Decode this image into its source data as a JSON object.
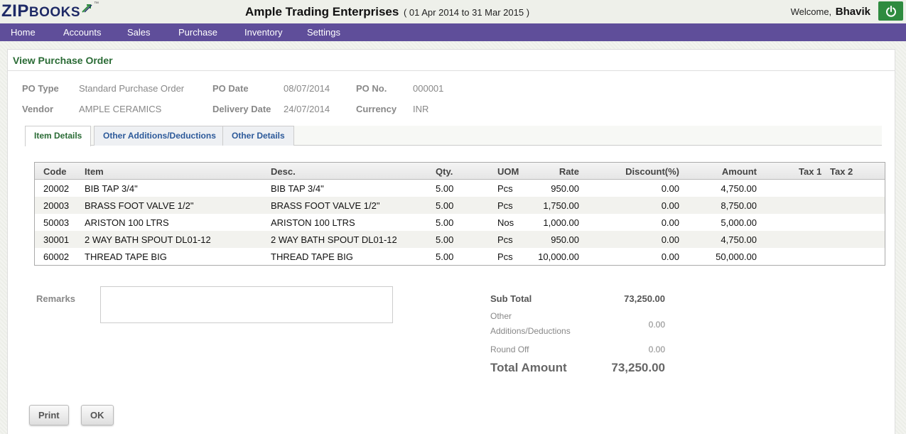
{
  "header": {
    "logo_main": "ZIP",
    "logo_rest": "BOOKS",
    "logo_tm": "™",
    "company_name": "Ample Trading Enterprises",
    "period": "( 01 Apr 2014 to 31 Mar 2015 )",
    "welcome_text": "Welcome,",
    "user_name": "Bhavik",
    "power_icon": "power-icon",
    "power_color": "#2e8b3f"
  },
  "nav": {
    "items": [
      "Home",
      "Accounts",
      "Sales",
      "Purchase",
      "Inventory",
      "Settings"
    ],
    "bg_color": "#5f4e9a"
  },
  "page": {
    "title": "View Purchase Order"
  },
  "po": {
    "type_label": "PO Type",
    "type_value": "Standard Purchase Order",
    "date_label": "PO Date",
    "date_value": "08/07/2014",
    "no_label": "PO No.",
    "no_value": "000001",
    "vendor_label": "Vendor",
    "vendor_value": "AMPLE CERAMICS",
    "delivery_label": "Delivery Date",
    "delivery_value": "24/07/2014",
    "currency_label": "Currency",
    "currency_value": "INR"
  },
  "tabs": [
    {
      "label": "Item Details",
      "active": true
    },
    {
      "label": "Other Additions/Deductions",
      "active": false
    },
    {
      "label": "Other Details",
      "active": false
    }
  ],
  "table": {
    "headers": {
      "code": "Code",
      "item": "Item",
      "desc": "Desc.",
      "qty": "Qty.",
      "uom": "UOM",
      "rate": "Rate",
      "discount": "Discount(%)",
      "amount": "Amount",
      "tax1": "Tax 1",
      "tax2": "Tax 2"
    },
    "rows": [
      {
        "code": "20002",
        "item": "BIB TAP 3/4\"",
        "desc": "BIB TAP 3/4\"",
        "qty": "5.00",
        "uom": "Pcs",
        "rate": "950.00",
        "discount": "0.00",
        "amount": "4,750.00"
      },
      {
        "code": "20003",
        "item": "BRASS FOOT VALVE 1/2\"",
        "desc": "BRASS FOOT VALVE 1/2\"",
        "qty": "5.00",
        "uom": "Pcs",
        "rate": "1,750.00",
        "discount": "0.00",
        "amount": "8,750.00"
      },
      {
        "code": "50003",
        "item": "ARISTON 100 LTRS",
        "desc": "ARISTON 100 LTRS",
        "qty": "5.00",
        "uom": "Nos",
        "rate": "1,000.00",
        "discount": "0.00",
        "amount": "5,000.00"
      },
      {
        "code": "30001",
        "item": "2 WAY BATH SPOUT DL01-12",
        "desc": "2 WAY BATH SPOUT DL01-12",
        "qty": "5.00",
        "uom": "Pcs",
        "rate": "950.00",
        "discount": "0.00",
        "amount": "4,750.00"
      },
      {
        "code": "60002",
        "item": "THREAD TAPE BIG",
        "desc": "THREAD TAPE BIG",
        "qty": "5.00",
        "uom": "Pcs",
        "rate": "10,000.00",
        "discount": "0.00",
        "amount": "50,000.00"
      }
    ]
  },
  "remarks": {
    "label": "Remarks",
    "value": ""
  },
  "totals": {
    "subtotal_label": "Sub Total",
    "subtotal_value": "73,250.00",
    "other_label_1": "Other",
    "other_label_2": "Additions/Deductions",
    "other_value": "0.00",
    "roundoff_label": "Round Off",
    "roundoff_value": "0.00",
    "total_label": "Total Amount",
    "total_value": "73,250.00"
  },
  "buttons": {
    "print": "Print",
    "ok": "OK"
  }
}
